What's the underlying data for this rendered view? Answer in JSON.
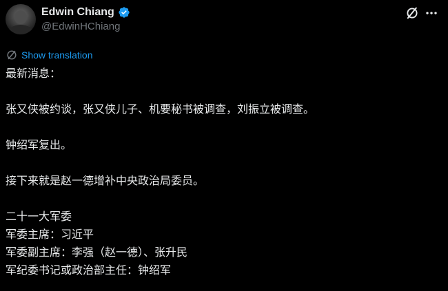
{
  "author": {
    "display_name": "Edwin Chiang",
    "handle": "@EdwinHChiang",
    "verified": true,
    "verified_color": "#1d9bf0"
  },
  "actions": {
    "grok_icon": "grok-icon",
    "more_icon": "more-horizontal-icon"
  },
  "translation": {
    "icon": "translate-icon",
    "label": "Show translation",
    "color": "#1d9bf0"
  },
  "tweet": {
    "lines": [
      "最新消息：",
      "",
      "张又侠被约谈，张又侠儿子、机要秘书被调查，刘振立被调查。",
      "",
      "钟绍军复出。",
      "",
      "接下来就是赵一德增补中央政治局委员。",
      "",
      "二十一大军委",
      "军委主席：习近平",
      "军委副主席：李强（赵一德）、张升民",
      "军纪委书记或政治部主任：钟绍军"
    ]
  },
  "colors": {
    "background": "#000000",
    "text_primary": "#e7e9ea",
    "text_secondary": "#71767b",
    "accent": "#1d9bf0"
  }
}
